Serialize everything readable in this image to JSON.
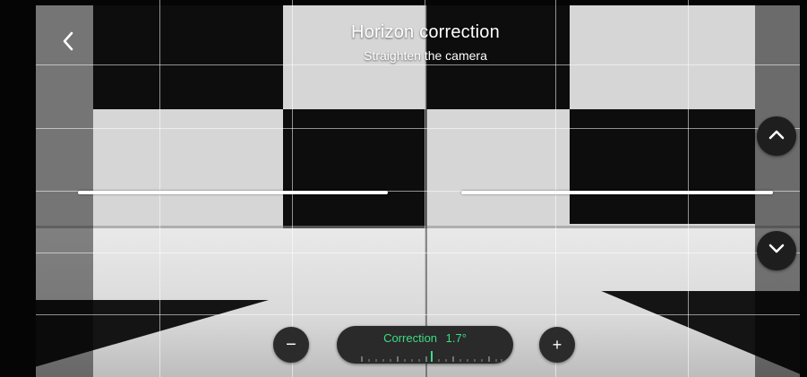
{
  "header": {
    "title": "Horizon correction",
    "subtitle": "Straighten the camera",
    "back_icon": "chevron-left-icon"
  },
  "controls": {
    "tilt_up_icon": "chevron-up-icon",
    "tilt_down_icon": "chevron-down-icon",
    "decrease_symbol": "−",
    "increase_symbol": "+"
  },
  "correction": {
    "label": "Correction",
    "value": "1.7°",
    "accent_color": "#3ddc84"
  },
  "colors": {
    "overlay_line": "#ffffff",
    "button_bg": "#1e1e1e"
  }
}
